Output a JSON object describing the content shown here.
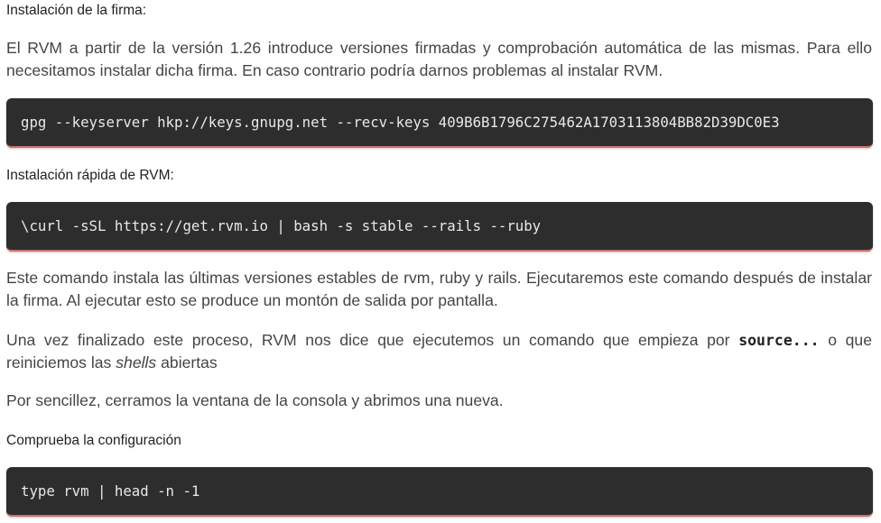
{
  "sections": {
    "firma_heading": "Instalación de la firma:",
    "firma_text": "El RVM a partir de la versión 1.26 introduce versiones firmadas y comprobación automática de las mismas. Para ello necesitamos instalar dicha firma. En caso contrario podría darnos problemas al instalar RVM.",
    "firma_code": "gpg --keyserver hkp://keys.gnupg.net --recv-keys 409B6B1796C275462A1703113804BB82D39DC0E3",
    "rapida_heading": "Instalación rápida de RVM:",
    "rapida_code": "\\curl -sSL https://get.rvm.io | bash -s stable --rails --ruby",
    "comando_text": "Este comando instala las últimas versiones estables de rvm, ruby y rails. Ejecutaremos este comando después de instalar la firma. Al ejecutar esto se produce un montón de salida por pantalla.",
    "proceso_text_before": "Una vez finalizado este proceso, RVM nos dice que ejecutemos un comando que empieza por",
    "proceso_code": "source...",
    "proceso_text_middle": "o que reiniciemos las",
    "proceso_text_em": "shells",
    "proceso_text_after": "abiertas",
    "sencillez_text": "Por sencillez, cerramos la ventana de la consola y abrimos una nueva.",
    "config_heading": "Comprueba la configuración",
    "config_code": "type rvm | head -n -1"
  }
}
